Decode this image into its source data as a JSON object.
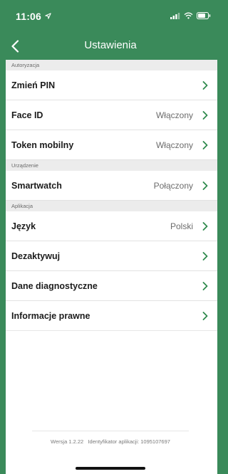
{
  "status": {
    "time": "11:06",
    "icons": [
      "location-arrow-icon",
      "signal-icon",
      "wifi-icon",
      "battery-icon"
    ]
  },
  "nav": {
    "title": "Ustawienia",
    "back_icon": "chevron-left-icon"
  },
  "sections": [
    {
      "title": "Autoryzacja",
      "rows": [
        {
          "label": "Zmień PIN",
          "value": ""
        },
        {
          "label": "Face ID",
          "value": "Włączony"
        },
        {
          "label": "Token mobilny",
          "value": "Włączony"
        }
      ]
    },
    {
      "title": "Urządzenie",
      "rows": [
        {
          "label": "Smartwatch",
          "value": "Połączony"
        }
      ]
    },
    {
      "title": "Aplikacja",
      "rows": [
        {
          "label": "Język",
          "value": "Polski"
        },
        {
          "label": "Dezaktywuj",
          "value": ""
        },
        {
          "label": "Dane diagnostyczne",
          "value": ""
        },
        {
          "label": "Informacje prawne",
          "value": ""
        }
      ]
    }
  ],
  "footer": {
    "version": "Wersja 1.2.22",
    "app_id": "Identyfikator aplikacji: 1095107697"
  },
  "colors": {
    "brand_green": "#3a8a5a",
    "chevron_green": "#2f8a4e"
  }
}
